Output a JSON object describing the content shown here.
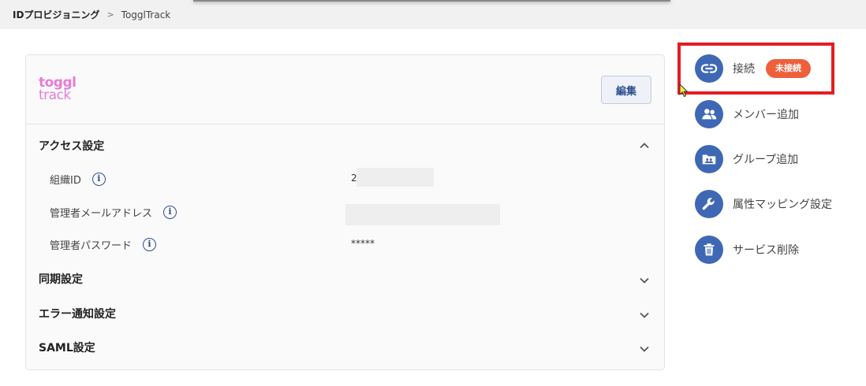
{
  "breadcrumb": {
    "root": "IDプロビジョニング",
    "separator": ">",
    "current": "TogglTrack"
  },
  "logo": {
    "line1": "toggl",
    "line2": "track",
    "color": "#e57cd8"
  },
  "edit_button": {
    "label": "編集"
  },
  "sections": [
    {
      "title": "アクセス設定",
      "expanded": true
    },
    {
      "title": "同期設定",
      "expanded": false
    },
    {
      "title": "エラー通知設定",
      "expanded": false
    },
    {
      "title": "SAML設定",
      "expanded": false
    }
  ],
  "fields": [
    {
      "label": "組織ID",
      "value": "2"
    },
    {
      "label": "管理者メールアドレス",
      "value": ""
    },
    {
      "label": "管理者パスワード",
      "value": "*****"
    }
  ],
  "side_menu": [
    {
      "icon": "link-icon",
      "label": "接続",
      "badge": "未接続"
    },
    {
      "icon": "users-icon",
      "label": "メンバー追加"
    },
    {
      "icon": "group-folder-icon",
      "label": "グループ追加"
    },
    {
      "icon": "wrench-icon",
      "label": "属性マッピング設定"
    },
    {
      "icon": "trash-icon",
      "label": "サービス削除"
    }
  ],
  "colors": {
    "accent": "#3f68b4",
    "badge": "#ee5f3c",
    "highlight": "#e51c23",
    "edit_text": "#2d4f8f"
  }
}
